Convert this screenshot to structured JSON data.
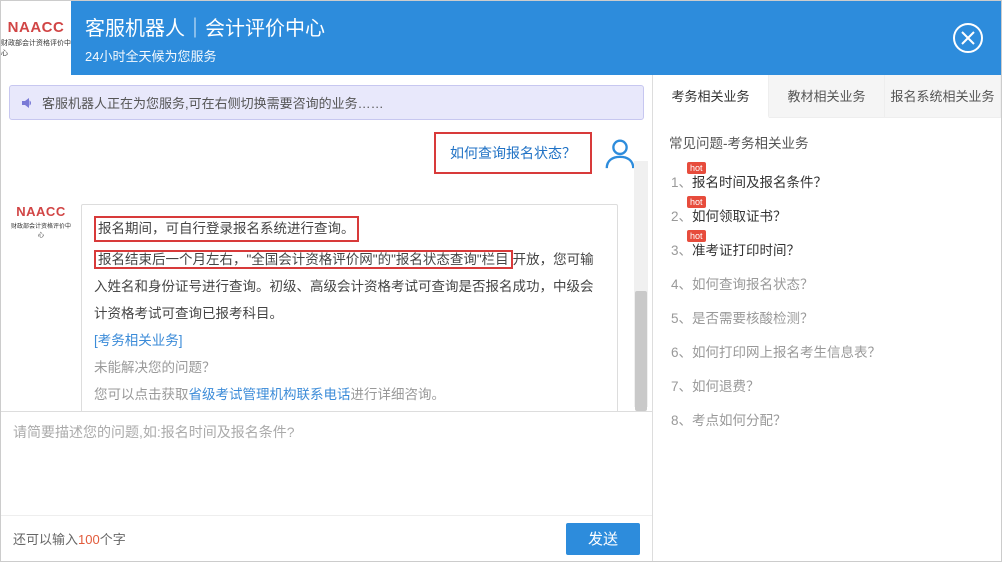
{
  "logo": {
    "main": "NAACC",
    "sub": "财政部会计资格评价中心"
  },
  "header": {
    "title": "客服机器人｜会计评价中心",
    "subtitle": "24小时全天候为您服务"
  },
  "status": "客服机器人正在为您服务,可在右侧切换需要咨询的业务……",
  "user_msg": "如何查询报名状态？",
  "bot": {
    "p1": "报名期间，可自行登录报名系统进行查询。",
    "p2a": "报名结束后一个月左右，\"全国会计资格评价网\"的\"报名状态查询\"栏目",
    "p2b": "开放，您可输入姓名和身份证号进行查询。初级、高级会计资格考试可查询是否报名成功，中级会计资格考试可查询已报考科目。",
    "tag": "[考务相关业务]",
    "q": "未能解决您的问题？",
    "hint_a": "您可以点击获取",
    "hint_link": "省级考试管理机构联系电话",
    "hint_b": "进行详细咨询。"
  },
  "input": {
    "placeholder": "请简要描述您的问题,如:报名时间及报名条件?"
  },
  "char": {
    "prefix": "还可以输入",
    "count": "100",
    "suffix": "个字"
  },
  "send": "发送",
  "tabs": [
    "考务相关业务",
    "教材相关业务",
    "报名系统相关业务"
  ],
  "faq": {
    "title": "常见问题-考务相关业务",
    "items": [
      {
        "n": "1、",
        "t": "报名时间及报名条件？",
        "hot": true
      },
      {
        "n": "2、",
        "t": "如何领取证书？",
        "hot": true
      },
      {
        "n": "3、",
        "t": "准考证打印时间？",
        "hot": true
      },
      {
        "n": "4、",
        "t": "如何查询报名状态？",
        "hot": false
      },
      {
        "n": "5、",
        "t": "是否需要核酸检测？",
        "hot": false
      },
      {
        "n": "6、",
        "t": "如何打印网上报名考生信息表？",
        "hot": false
      },
      {
        "n": "7、",
        "t": "如何退费？",
        "hot": false
      },
      {
        "n": "8、",
        "t": "考点如何分配？",
        "hot": false
      }
    ]
  },
  "hot_label": "hot"
}
